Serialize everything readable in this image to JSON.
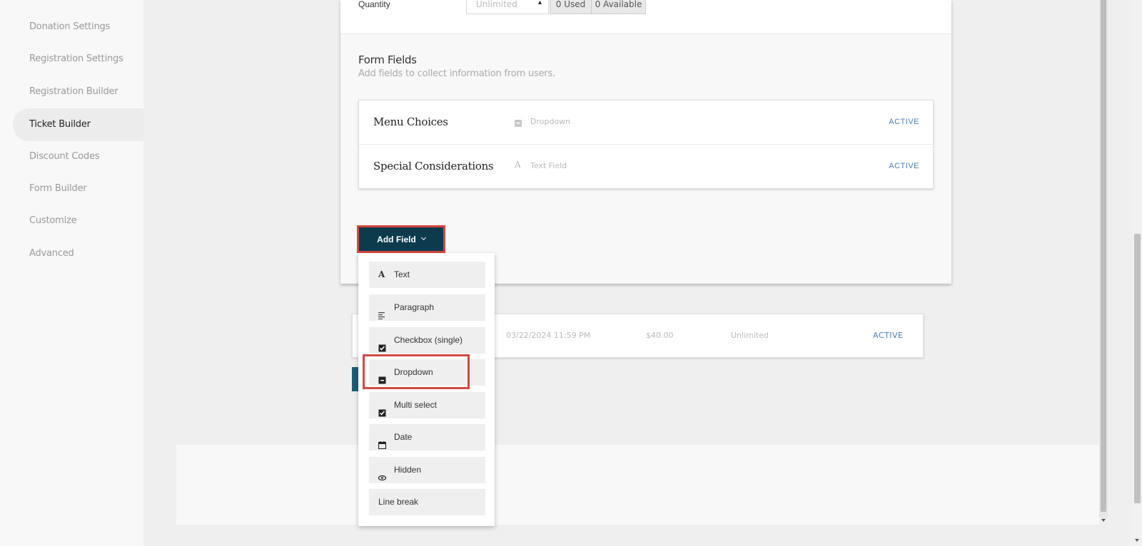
{
  "sidebar": {
    "items": [
      {
        "label": "Donation Settings"
      },
      {
        "label": "Registration Settings"
      },
      {
        "label": "Registration Builder"
      },
      {
        "label": "Ticket Builder",
        "active": true
      },
      {
        "label": "Discount Codes"
      },
      {
        "label": "Form Builder"
      },
      {
        "label": "Customize"
      },
      {
        "label": "Advanced"
      }
    ]
  },
  "quantity": {
    "label": "Quantity",
    "placeholder": "Unlimited",
    "used": "0 Used",
    "available": "0 Available"
  },
  "form_fields": {
    "title": "Form Fields",
    "subtitle": "Add fields to collect information from users.",
    "fields": [
      {
        "name": "Menu Choices",
        "type_icon": "dropdown-icon",
        "type": "Dropdown",
        "status": "ACTIVE"
      },
      {
        "name": "Special Considerations",
        "type_icon": "text-a-icon",
        "type": "Text Field",
        "status": "ACTIVE"
      }
    ]
  },
  "add_field": {
    "label": "Add Field",
    "menu": [
      {
        "label": "Text",
        "icon": "text-a-icon"
      },
      {
        "label": "Paragraph",
        "icon": "paragraph-icon"
      },
      {
        "label": "Checkbox (single)",
        "icon": "checkbox-icon"
      },
      {
        "label": "Dropdown",
        "icon": "dropdown-icon"
      },
      {
        "label": "Multi select",
        "icon": "checkbox-icon"
      },
      {
        "label": "Date",
        "icon": "calendar-icon"
      },
      {
        "label": "Hidden",
        "icon": "eye-icon"
      },
      {
        "label": "Line break",
        "icon": ""
      }
    ]
  },
  "ticket_row": {
    "date": "03/22/2024 11:59 PM",
    "price": "$40.00",
    "quantity": "Unlimited",
    "status": "ACTIVE"
  },
  "colors": {
    "accent_dark": "#0c3b4e",
    "highlight_red": "#d4493f",
    "status_blue": "#4a7eb0"
  }
}
